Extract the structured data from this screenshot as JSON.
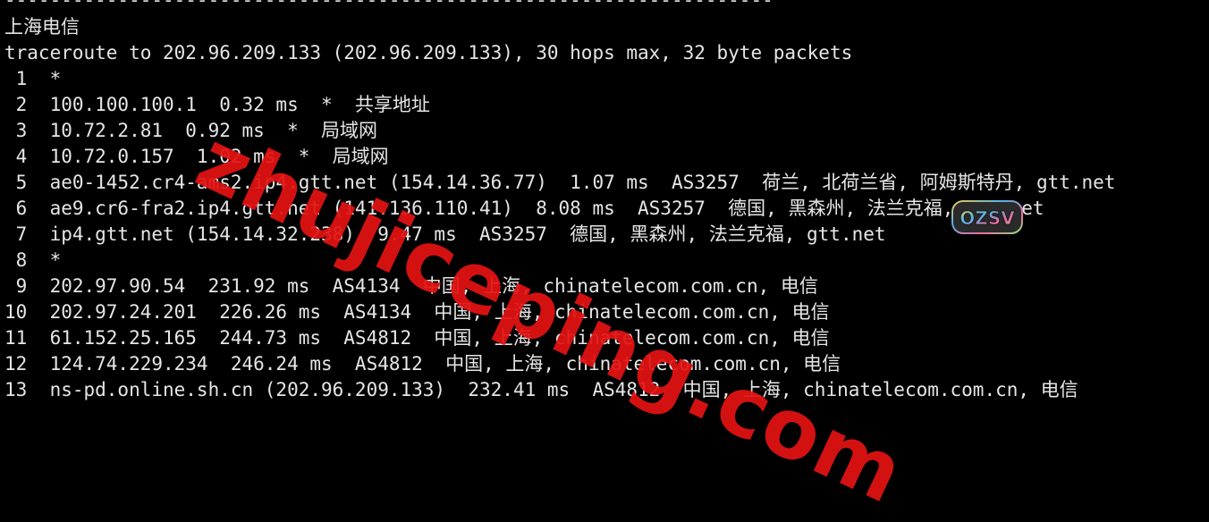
{
  "terminal": {
    "separator": "--------------------------------------------------------------------",
    "title": "上海电信",
    "header": "traceroute to 202.96.209.133 (202.96.209.133), 30 hops max, 32 byte packets",
    "hops": [
      " 1  *",
      " 2  100.100.100.1  0.32 ms  *  共享地址",
      " 3  10.72.2.81  0.92 ms  *  局域网",
      " 4  10.72.0.157  1.02 ms  *  局域网",
      " 5  ae0-1452.cr4-ams2.ip4.gtt.net (154.14.36.77)  1.07 ms  AS3257  荷兰, 北荷兰省, 阿姆斯特丹, gtt.net",
      " 6  ae9.cr6-fra2.ip4.gtt.net (141.136.110.41)  8.08 ms  AS3257  德国, 黑森州, 法兰克福, gtt.net",
      " 7  ip4.gtt.net (154.14.32.238)  9.47 ms  AS3257  德国, 黑森州, 法兰克福, gtt.net",
      " 8  *",
      " 9  202.97.90.54  231.92 ms  AS4134  中国, 上海, chinatelecom.com.cn, 电信",
      "10  202.97.24.201  226.26 ms  AS4134  中国, 上海, chinatelecom.com.cn, 电信",
      "11  61.152.25.165  244.73 ms  AS4812  中国, 上海, chinatelecom.com.cn, 电信",
      "12  124.74.229.234  246.24 ms  AS4812  中国, 上海, chinatelecom.com.cn, 电信",
      "13  ns-pd.online.sh.cn (202.96.209.133)  232.41 ms  AS4812  中国, 上海, chinatelecom.com.cn, 电信"
    ]
  },
  "watermark": {
    "text": "zhujiceping.com",
    "color": "#e41212"
  },
  "logo": {
    "text": "OZSV",
    "colors": [
      "#f3c84a",
      "#4fb4e8",
      "#f06aa0",
      "#8be07a"
    ]
  }
}
